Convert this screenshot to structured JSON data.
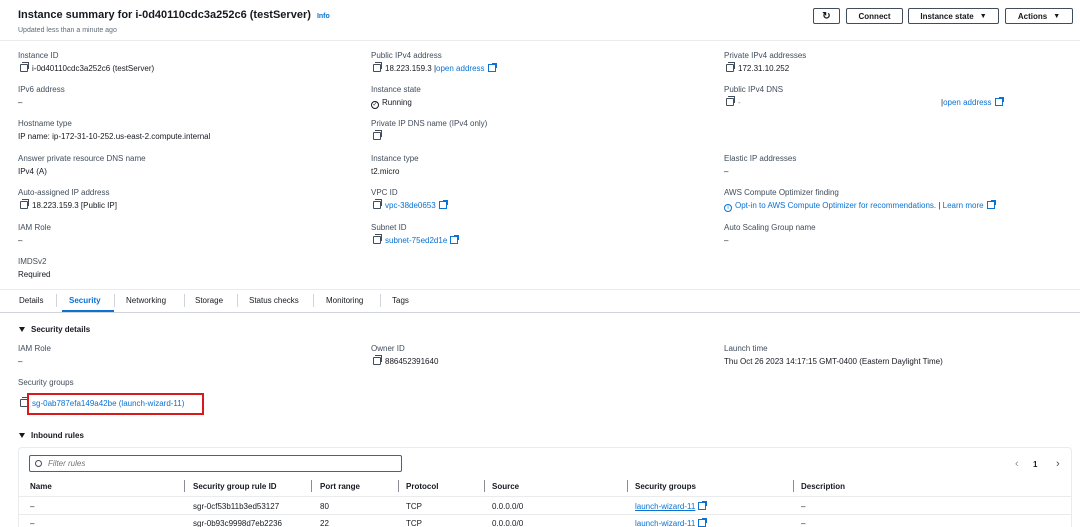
{
  "header": {
    "title": "Instance summary for i-0d40110cdc3a252c6 (testServer)",
    "info": "Info",
    "updated": "Updated less than a minute ago",
    "buttons": {
      "connect": "Connect",
      "instance_state": "Instance state",
      "actions": "Actions"
    },
    "refresh_icon": "refresh-icon"
  },
  "summary": {
    "instance_id": {
      "label": "Instance ID",
      "value": "i-0d40110cdc3a252c6 (testServer)"
    },
    "ipv6": {
      "label": "IPv6 address",
      "value": "–"
    },
    "hostname_type": {
      "label": "Hostname type",
      "value": "IP name: ip-172-31-10-252.us-east-2.compute.internal"
    },
    "answer_dns": {
      "label": "Answer private resource DNS name",
      "value": "IPv4 (A)"
    },
    "auto_ip": {
      "label": "Auto-assigned IP address",
      "value": "18.223.159.3 [Public IP]"
    },
    "iam_role": {
      "label": "IAM Role",
      "value": "–"
    },
    "imdsv2": {
      "label": "IMDSv2",
      "value": "Required"
    },
    "public_ipv4": {
      "label": "Public IPv4 address",
      "value": "18.223.159.3",
      "sep": "|",
      "link": "open address"
    },
    "instance_state": {
      "label": "Instance state",
      "value": "Running"
    },
    "private_ip_dns": {
      "label": "Private IP DNS name (IPv4 only)"
    },
    "instance_type": {
      "label": "Instance type",
      "value": "t2.micro"
    },
    "vpc": {
      "label": "VPC ID",
      "value": "vpc-38de0653"
    },
    "subnet": {
      "label": "Subnet ID",
      "value": "subnet-75ed2d1e"
    },
    "private_ipv4": {
      "label": "Private IPv4 addresses",
      "value": "172.31.10.252"
    },
    "public_dns": {
      "label": "Public IPv4 DNS",
      "value": "-",
      "link": "open address"
    },
    "elastic_ip": {
      "label": "Elastic IP addresses",
      "value": "–"
    },
    "optimizer": {
      "label": "AWS Compute Optimizer finding",
      "value": "Opt-in to AWS Compute Optimizer for recommendations.",
      "sep": "|",
      "link": "Learn more"
    },
    "asg": {
      "label": "Auto Scaling Group name",
      "value": "–"
    }
  },
  "tabs": [
    "Details",
    "Security",
    "Networking",
    "Storage",
    "Status checks",
    "Monitoring",
    "Tags"
  ],
  "security_details": {
    "heading": "Security details",
    "iam_role": {
      "label": "IAM Role",
      "value": "–"
    },
    "owner_id": {
      "label": "Owner ID",
      "value": "886452391640"
    },
    "launch_time": {
      "label": "Launch time",
      "value": "Thu Oct 26 2023 14:17:15 GMT-0400 (Eastern Daylight Time)"
    },
    "security_groups": {
      "label": "Security groups",
      "value": "sg-0ab787efa149a42be (launch-wizard-11)"
    }
  },
  "inbound_rules": {
    "heading": "Inbound rules",
    "filter_placeholder": "Filter rules",
    "pagination": {
      "prev": "‹",
      "page": "1",
      "next": "›"
    },
    "columns": [
      "Name",
      "Security group rule ID",
      "Port range",
      "Protocol",
      "Source",
      "Security groups",
      "Description"
    ],
    "rows": [
      {
        "name": "–",
        "rule_id": "sgr-0cf53b11b3ed53127",
        "port": "80",
        "protocol": "TCP",
        "source": "0.0.0.0/0",
        "sg": "launch-wizard-11",
        "desc": "–"
      },
      {
        "name": "–",
        "rule_id": "sgr-0b93c9998d7eb2236",
        "port": "22",
        "protocol": "TCP",
        "source": "0.0.0.0/0",
        "sg": "launch-wizard-11",
        "desc": "–"
      }
    ]
  },
  "colors": {
    "link": "#0972d3",
    "highlight_box": "#d91a1a",
    "tab_active": "#0972d3"
  }
}
